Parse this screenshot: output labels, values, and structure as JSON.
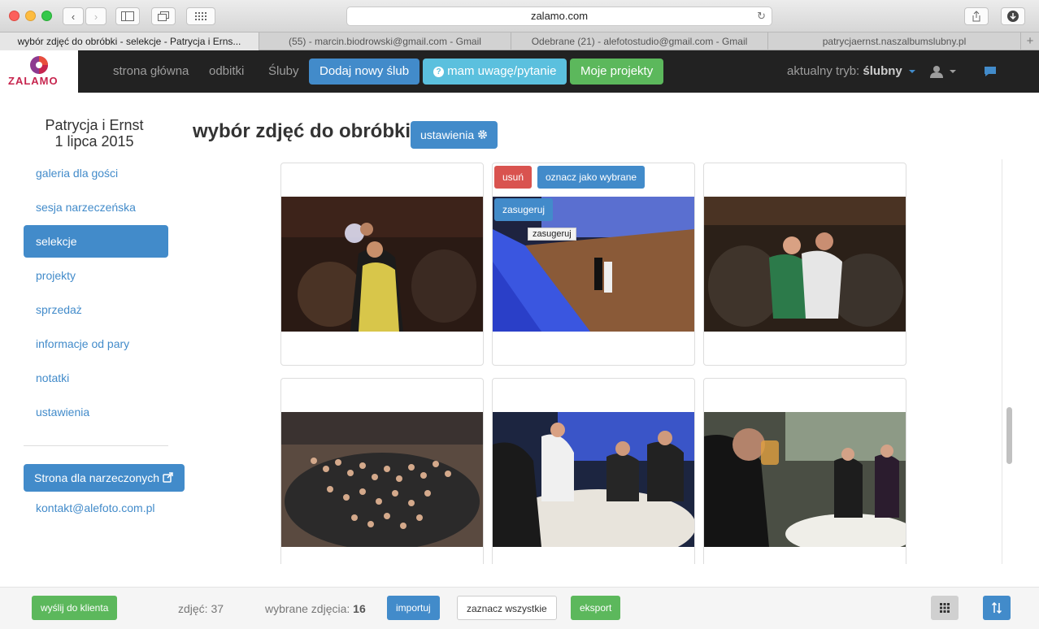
{
  "browser": {
    "url": "zalamo.com",
    "tabs": [
      "wybór zdjęć do obróbki - selekcje - Patrycja i Erns...",
      "(55) - marcin.biodrowski@gmail.com - Gmail",
      "Odebrane (21) - alefotostudio@gmail.com - Gmail",
      "patrycjaernst.naszalbumslubny.pl"
    ]
  },
  "navbar": {
    "brand": "ZALAMO",
    "links": [
      "strona główna",
      "odbitki",
      "Śluby"
    ],
    "add_wedding": "Dodaj nowy ślub",
    "question": "mam uwagę/pytanie",
    "projects": "Moje projekty",
    "mode_label": "aktualny tryb:",
    "mode_value": "ślubny"
  },
  "sidebar": {
    "couple": "Patrycja i Ernst",
    "date": "1 lipca 2015",
    "items": [
      "galeria dla gości",
      "sesja narzeczeńska",
      "selekcje",
      "projekty",
      "sprzedaż",
      "informacje od pary",
      "notatki",
      "ustawienia"
    ],
    "active_index": 2,
    "couple_page_btn": "Strona dla narzeczonych",
    "contact": "kontakt@alefoto.com.pl"
  },
  "main": {
    "title": "wybór zdjęć do obróbki",
    "settings_btn": "ustawienia",
    "card_actions": {
      "remove": "usuń",
      "mark_selected": "oznacz jako wybrane",
      "suggest": "zasugeruj",
      "tooltip": "zasugeruj"
    }
  },
  "footer": {
    "send": "wyślij do klienta",
    "photos_label": "zdjęć:",
    "photos_count": "37",
    "selected_label": "wybrane zdjęcia:",
    "selected_count": "16",
    "import": "importuj",
    "select_all": "zaznacz wszystkie",
    "export": "eksport"
  },
  "colors": {
    "primary": "#428bca",
    "info": "#5bc0de",
    "success": "#5cb85c",
    "danger": "#d9534f",
    "navbar": "#222222"
  }
}
